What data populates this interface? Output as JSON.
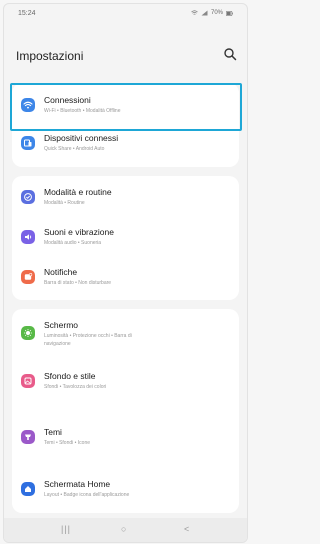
{
  "status": {
    "time": "15:24",
    "battery": "70%"
  },
  "header": {
    "title": "Impostazioni"
  },
  "groups": [
    {
      "items": [
        {
          "label": "Connessioni",
          "sub": "Wi-Fi • Bluetooth • Modalità Offline",
          "icon": "wifi-icon",
          "color": "#3d86e8"
        },
        {
          "label": "Dispositivi connessi",
          "sub": "Quick Share • Android Auto",
          "icon": "devices-icon",
          "color": "#3d86e8"
        }
      ]
    },
    {
      "items": [
        {
          "label": "Modalità e routine",
          "sub": "Modalità • Routine",
          "icon": "check-circle-icon",
          "color": "#5b6fe0"
        },
        {
          "label": "Suoni e vibrazione",
          "sub": "Modalità audio • Suoneria",
          "icon": "speaker-icon",
          "color": "#7a62e6"
        },
        {
          "label": "Notifiche",
          "sub": "Barra di stato • Non disturbare",
          "icon": "notification-icon",
          "color": "#ef6b4a"
        }
      ]
    },
    {
      "items": [
        {
          "label": "Schermo",
          "sub": "Luminosità • Protezione occhi • Barra di",
          "sub2": "navigazione",
          "icon": "brightness-icon",
          "color": "#58b947"
        },
        {
          "label": "Sfondo e stile",
          "sub": "Sfondi • Tavolozza dei colori",
          "icon": "wallpaper-icon",
          "color": "#e85b8a"
        },
        {
          "label": "Temi",
          "sub": "Temi • Sfondi • Icone",
          "icon": "theme-icon",
          "color": "#9b59c9"
        },
        {
          "label": "Schermata Home",
          "sub": "Layout • Badge icona dell'applicazione",
          "icon": "home-icon",
          "color": "#2f6fe0"
        }
      ]
    }
  ],
  "navbar": {
    "recents": "|||",
    "home": "○",
    "back": "<"
  }
}
